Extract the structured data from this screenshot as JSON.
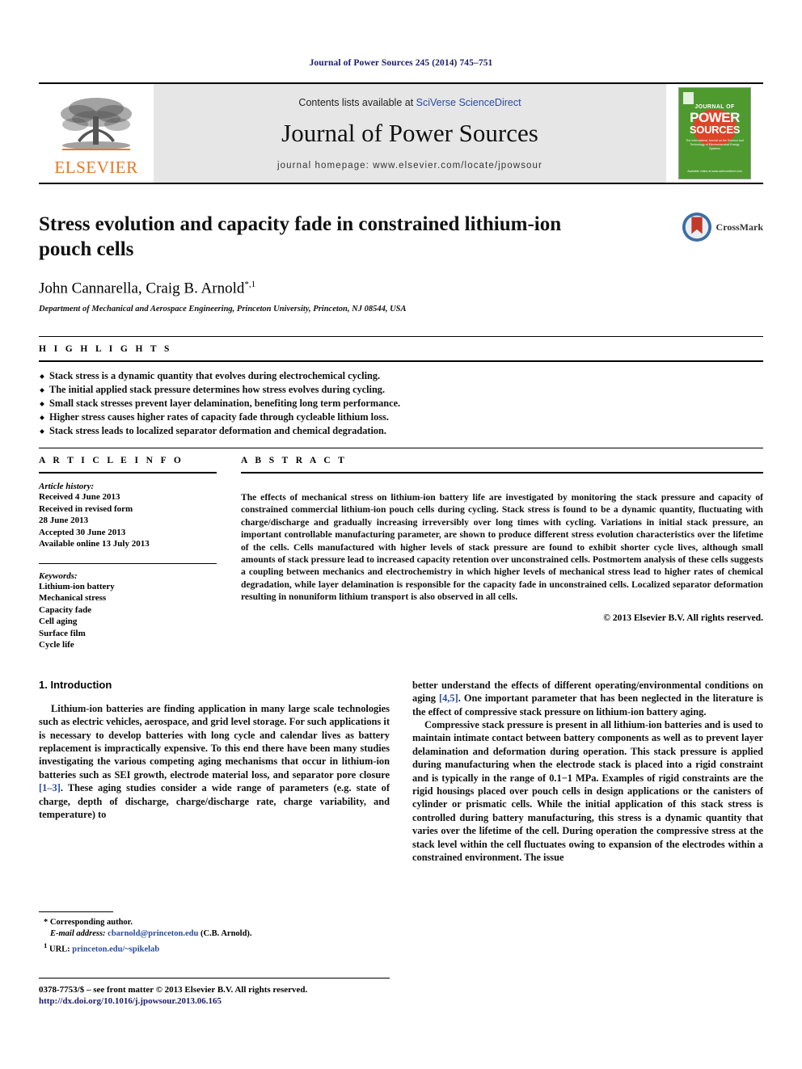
{
  "running_head": "Journal of Power Sources 245 (2014) 745–751",
  "masthead": {
    "publisher_logo_label": "ELSEVIER",
    "contents_prefix": "Contents lists available at ",
    "contents_link": "SciVerse ScienceDirect",
    "journal_name": "Journal of Power Sources",
    "homepage_line": "journal homepage: www.elsevier.com/locate/jpowsour",
    "cover": {
      "line_journal_of": "JOURNAL OF",
      "line_power": "POWER",
      "line_sources": "SOURCES",
      "subtitle": "The International Journal on the Science and Technology of Electrochemical Energy Systems",
      "footer": "Available online at www.sciencedirect.com"
    }
  },
  "article": {
    "title": "Stress evolution and capacity fade in constrained lithium-ion pouch cells",
    "authors": "John Cannarella, Craig B. Arnold",
    "author_marks": "*,1",
    "affiliation": "Department of Mechanical and Aerospace Engineering, Princeton University, Princeton, NJ 08544, USA",
    "crossmark_label": "CrossMark"
  },
  "highlights": {
    "heading": "H I G H L I G H T S",
    "items": [
      "Stack stress is a dynamic quantity that evolves during electrochemical cycling.",
      "The initial applied stack pressure determines how stress evolves during cycling.",
      "Small stack stresses prevent layer delamination, benefiting long term performance.",
      "Higher stress causes higher rates of capacity fade through cycleable lithium loss.",
      "Stack stress leads to localized separator deformation and chemical degradation."
    ]
  },
  "article_info": {
    "heading": "A R T I C L E    I N F O",
    "history_label": "Article history:",
    "history": [
      "Received 4 June 2013",
      "Received in revised form",
      "28 June 2013",
      "Accepted 30 June 2013",
      "Available online 13 July 2013"
    ],
    "keywords_label": "Keywords:",
    "keywords": [
      "Lithium-ion battery",
      "Mechanical stress",
      "Capacity fade",
      "Cell aging",
      "Surface film",
      "Cycle life"
    ]
  },
  "abstract": {
    "heading": "A B S T R A C T",
    "text": "The effects of mechanical stress on lithium-ion battery life are investigated by monitoring the stack pressure and capacity of constrained commercial lithium-ion pouch cells during cycling. Stack stress is found to be a dynamic quantity, fluctuating with charge/discharge and gradually increasing irreversibly over long times with cycling. Variations in initial stack pressure, an important controllable manufacturing parameter, are shown to produce different stress evolution characteristics over the lifetime of the cells. Cells manufactured with higher levels of stack pressure are found to exhibit shorter cycle lives, although small amounts of stack pressure lead to increased capacity retention over unconstrained cells. Postmortem analysis of these cells suggests a coupling between mechanics and electrochemistry in which higher levels of mechanical stress lead to higher rates of chemical degradation, while layer delamination is responsible for the capacity fade in unconstrained cells. Localized separator deformation resulting in nonuniform lithium transport is also observed in all cells.",
    "rights": "© 2013 Elsevier B.V. All rights reserved."
  },
  "introduction": {
    "section_number_title": "1.  Introduction",
    "left_paragraph_part1": "Lithium-ion batteries are finding application in many large scale technologies such as electric vehicles, aerospace, and grid level storage. For such applications it is necessary to develop batteries with long cycle and calendar lives as battery replacement is impractically expensive. To this end there have been many studies investigating the various competing aging mechanisms that occur in lithium-ion batteries such as SEI growth, electrode material loss, and separator pore closure ",
    "ref_1_3": "[1–3]",
    "left_paragraph_part2": ". These aging studies consider a wide range of parameters (e.g. state of charge, depth of discharge, charge/discharge rate, charge variability, and temperature) to ",
    "right_paragraph_1_part1": "better understand the effects of different operating/environmental conditions on aging ",
    "ref_4_5": "[4,5]",
    "right_paragraph_1_part2": ". One important parameter that has been neglected in the literature is the effect of compressive stack pressure on lithium-ion battery aging.",
    "right_paragraph_2": "Compressive stack pressure is present in all lithium-ion batteries and is used to maintain intimate contact between battery components as well as to prevent layer delamination and deformation during operation. This stack pressure is applied during manufacturing when the electrode stack is placed into a rigid constraint and is typically in the range of 0.1−1 MPa. Examples of rigid constraints are the rigid housings placed over pouch cells in design applications or the canisters of cylinder or prismatic cells. While the initial application of this stack stress is controlled during battery manufacturing, this stress is a dynamic quantity that varies over the lifetime of the cell. During operation the compressive stress at the stack level within the cell fluctuates owing to expansion of the electrodes within a constrained environment. The issue"
  },
  "footnotes": {
    "corresponding": "* Corresponding author.",
    "email_label": "E-mail address:",
    "email": "cbarnold@princeton.edu",
    "email_suffix": "(C.B. Arnold).",
    "url_marker": "1",
    "url_label": "URL:",
    "url": "princeton.edu/~spikelab"
  },
  "footer": {
    "issn_line": "0378-7753/$ – see front matter © 2013 Elsevier B.V. All rights reserved.",
    "doi": "http://dx.doi.org/10.1016/j.jpowsour.2013.06.165"
  },
  "colors": {
    "elsevier_orange": "#E87722",
    "link_blue": "#2a4b9b",
    "runhead_navy": "#1b1b6b",
    "cover_green": "#4e9a2f",
    "cover_red": "#d9462a"
  }
}
